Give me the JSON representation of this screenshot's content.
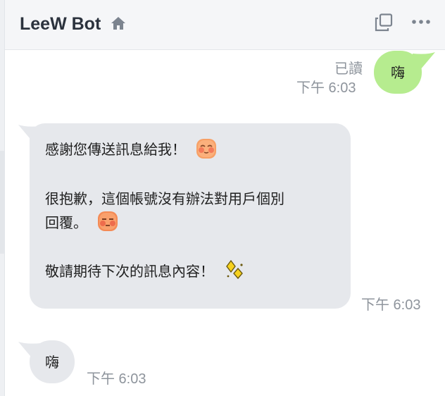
{
  "header": {
    "title": "LeeW Bot",
    "home_icon": "home-icon",
    "copy_icon": "copy-icon",
    "more_icon": "more-horizontal-icon"
  },
  "colors": {
    "sent_bubble": "#b6ec8f",
    "received_bubble": "#e6e8ec",
    "header_bg": "#f5f6f8",
    "meta_text": "#8e949c"
  },
  "messages": [
    {
      "direction": "outgoing",
      "text": "嗨",
      "status": "已讀",
      "time": "下午 6:03"
    },
    {
      "direction": "incoming",
      "lines": [
        "感謝您傳送訊息給我！",
        "很抱歉，這個帳號沒有辦法對用戶個別",
        "回覆。",
        "敬請期待下次的訊息內容！"
      ],
      "emojis": [
        "blushing-face-emoji",
        "sleepy-face-emoji",
        "sparkle-diamond-emoji"
      ],
      "time": "下午 6:03"
    },
    {
      "direction": "incoming",
      "text": "嗨",
      "time": "下午 6:03"
    }
  ]
}
